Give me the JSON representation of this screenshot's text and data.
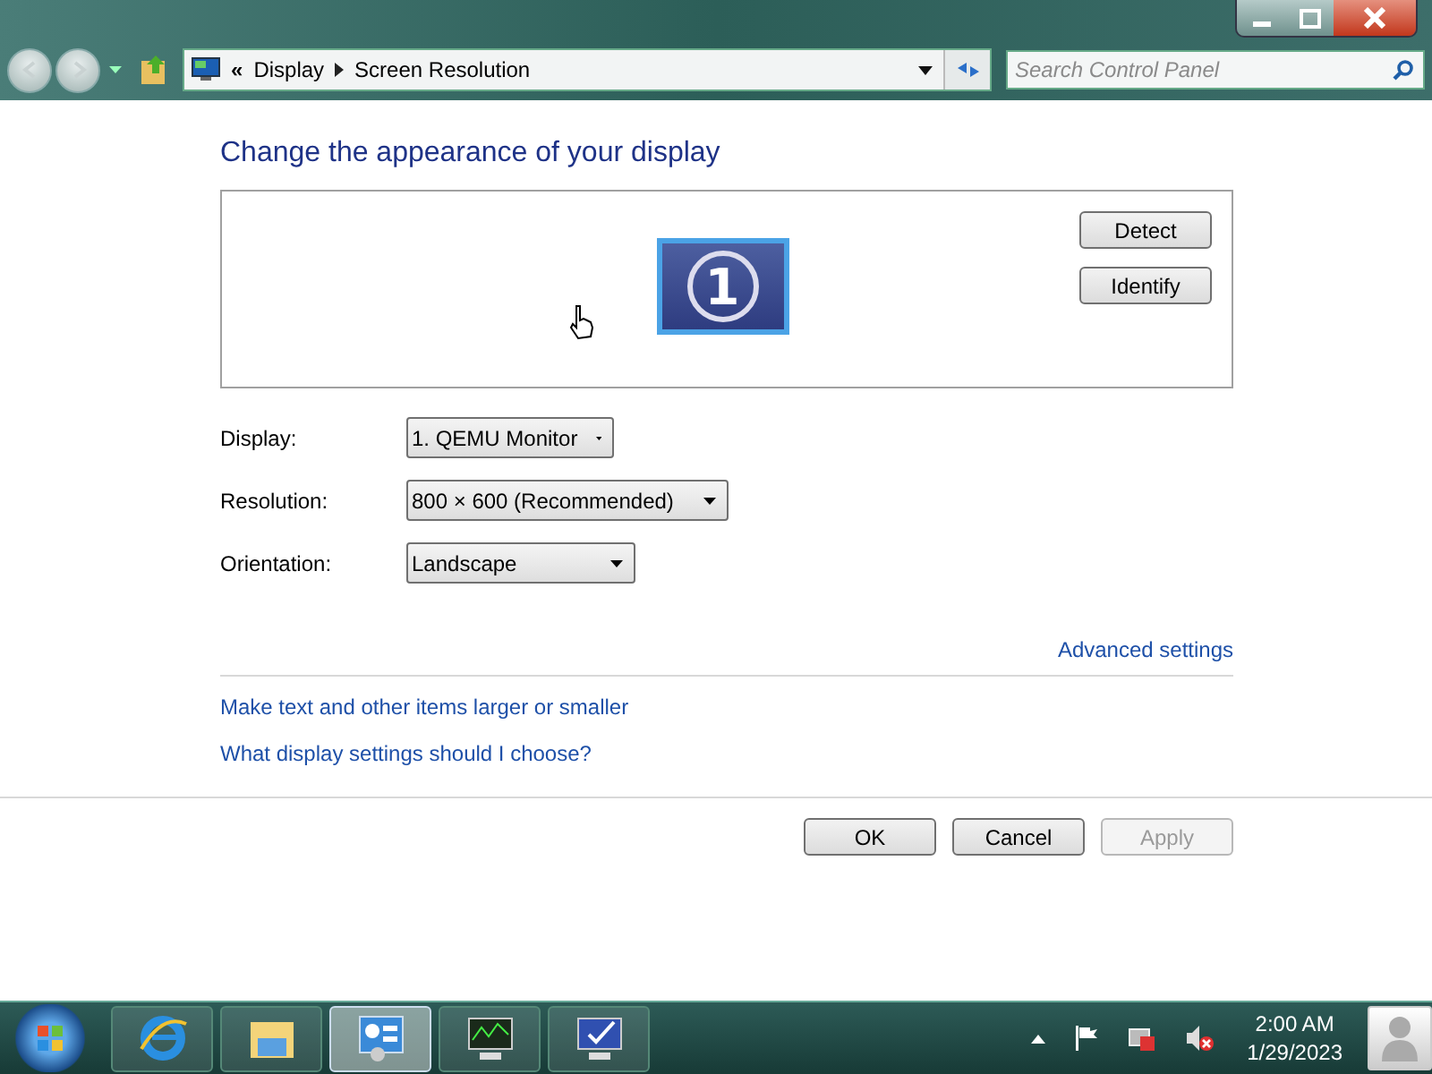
{
  "address_bar": {
    "overflow": "«",
    "crumbs": [
      "Display",
      "Screen Resolution"
    ]
  },
  "search": {
    "placeholder": "Search Control Panel"
  },
  "heading": "Change the appearance of your display",
  "monitor": {
    "number": "1"
  },
  "preview_buttons": [
    "Detect",
    "Identify"
  ],
  "settings": [
    {
      "label": "Display:",
      "value": "1. QEMU Monitor"
    },
    {
      "label": "Resolution:",
      "value": "800 × 600 (Recommended)"
    },
    {
      "label": "Orientation:",
      "value": "Landscape"
    }
  ],
  "advanced_link": "Advanced settings",
  "links": [
    "Make text and other items larger or smaller",
    "What display settings should I choose?"
  ],
  "buttons": [
    {
      "label": "OK",
      "disabled": false
    },
    {
      "label": "Cancel",
      "disabled": false
    },
    {
      "label": "Apply",
      "disabled": true
    }
  ],
  "taskbar": {
    "apps": [
      {
        "kind": "browser",
        "selected": false
      },
      {
        "kind": "folder",
        "selected": false
      },
      {
        "kind": "panel",
        "selected": true
      },
      {
        "kind": "monitor",
        "selected": false
      },
      {
        "kind": "display",
        "selected": false
      }
    ],
    "time": "2:00 AM",
    "date": "1/29/2023"
  }
}
